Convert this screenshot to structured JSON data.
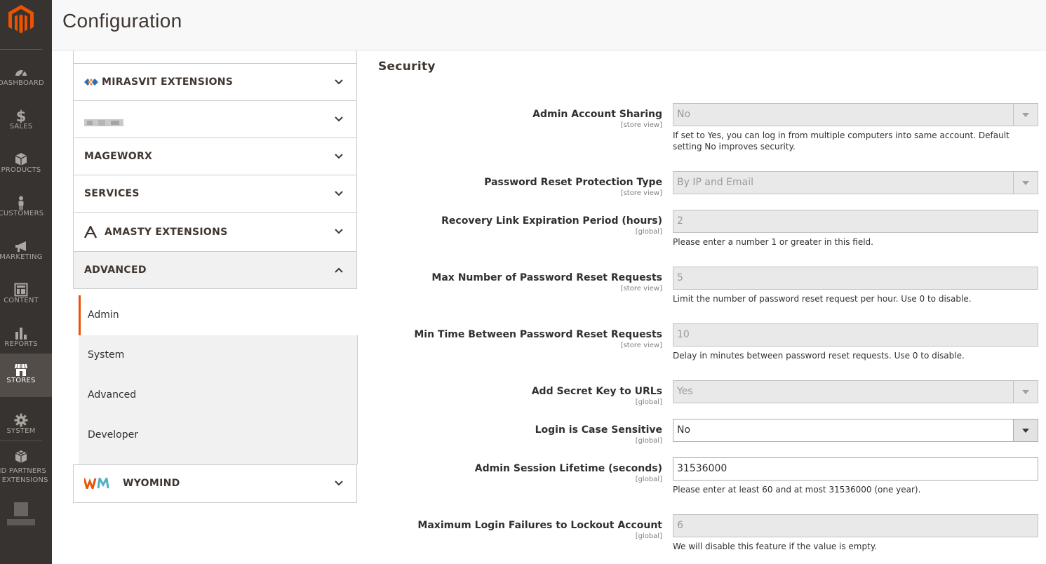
{
  "nav": {
    "items": [
      {
        "key": "dashboard",
        "label": "DASHBOARD",
        "icon": "dashboard-icon"
      },
      {
        "key": "sales",
        "label": "SALES",
        "icon": "dollar-icon"
      },
      {
        "key": "products",
        "label": "PRODUCTS",
        "icon": "box-icon"
      },
      {
        "key": "customers",
        "label": "CUSTOMERS",
        "icon": "person-icon"
      },
      {
        "key": "marketing",
        "label": "MARKETING",
        "icon": "megaphone-icon"
      },
      {
        "key": "content",
        "label": "CONTENT",
        "icon": "layout-icon"
      },
      {
        "key": "reports",
        "label": "REPORTS",
        "icon": "bar-chart-icon"
      },
      {
        "key": "stores",
        "label": "STORES",
        "icon": "store-icon"
      },
      {
        "key": "system",
        "label": "SYSTEM",
        "icon": "gear-icon"
      },
      {
        "key": "partners",
        "label": "ND PARTNERS & EXTENSIONS",
        "icon": "cubes-icon"
      }
    ],
    "active": "stores",
    "colors": {
      "background": "#373330",
      "active": "#524d49",
      "logo": "#eb5202"
    }
  },
  "header": {
    "title": "Configuration"
  },
  "tabs": {
    "groups": [
      {
        "label": "MIRASVIT EXTENSIONS",
        "logo": "mirasvit-logo"
      },
      {
        "label": "",
        "logo": "blurred-logo"
      },
      {
        "label": "MAGEWORX"
      },
      {
        "label": "SERVICES"
      },
      {
        "label": "AMASTY EXTENSIONS",
        "logo": "amasty-logo"
      },
      {
        "label": "ADVANCED",
        "expanded": true
      },
      {
        "label": "WYOMIND",
        "logo": "wyomind-logo"
      }
    ],
    "advanced_items": [
      "Admin",
      "System",
      "Advanced",
      "Developer"
    ],
    "active_item": "Admin",
    "accent": "#eb5202"
  },
  "section": {
    "title": "Security",
    "fields": [
      {
        "label": "Admin Account Sharing",
        "scope": "[store view]",
        "type": "select",
        "value": "No",
        "enabled": false,
        "note": "If set to Yes, you can log in from multiple computers into same account. Default setting No improves security."
      },
      {
        "label": "Password Reset Protection Type",
        "scope": "[store view]",
        "type": "select",
        "value": "By IP and Email",
        "enabled": false,
        "note": ""
      },
      {
        "label": "Recovery Link Expiration Period (hours)",
        "scope": "[global]",
        "type": "input",
        "value": "2",
        "enabled": false,
        "note": "Please enter a number 1 or greater in this field."
      },
      {
        "label": "Max Number of Password Reset Requests",
        "scope": "[store view]",
        "type": "input",
        "value": "5",
        "enabled": false,
        "note": "Limit the number of password reset request per hour. Use 0 to disable."
      },
      {
        "label": "Min Time Between Password Reset Requests",
        "scope": "[store view]",
        "type": "input",
        "value": "10",
        "enabled": false,
        "note": "Delay in minutes between password reset requests. Use 0 to disable."
      },
      {
        "label": "Add Secret Key to URLs",
        "scope": "[global]",
        "type": "select",
        "value": "Yes",
        "enabled": false,
        "note": ""
      },
      {
        "label": "Login is Case Sensitive",
        "scope": "[global]",
        "type": "select",
        "value": "No",
        "enabled": true,
        "note": ""
      },
      {
        "label": "Admin Session Lifetime (seconds)",
        "scope": "[global]",
        "type": "input",
        "value": "31536000",
        "enabled": true,
        "note": "Please enter at least 60 and at most 31536000 (one year)."
      },
      {
        "label": "Maximum Login Failures to Lockout Account",
        "scope": "[global]",
        "type": "input",
        "value": "6",
        "enabled": false,
        "note": "We will disable this feature if the value is empty."
      }
    ]
  }
}
